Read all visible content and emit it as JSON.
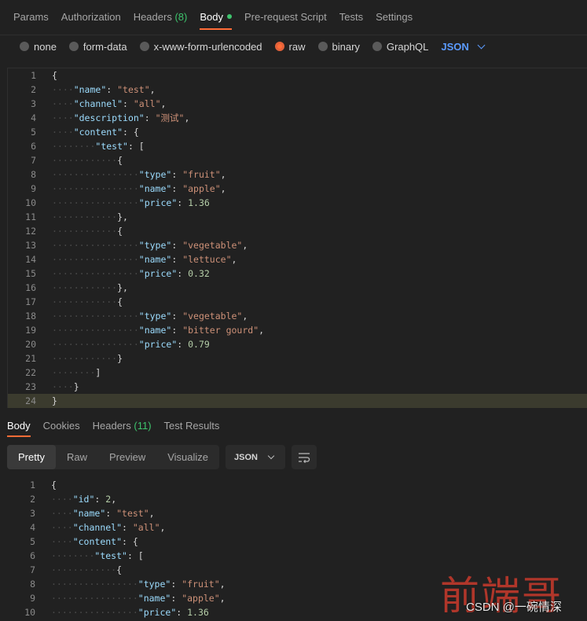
{
  "request_tabs": [
    {
      "label": "Params"
    },
    {
      "label": "Authorization"
    },
    {
      "label": "Headers",
      "count": "(8)"
    },
    {
      "label": "Body"
    },
    {
      "label": "Pre-request Script"
    },
    {
      "label": "Tests"
    },
    {
      "label": "Settings"
    }
  ],
  "body_types": [
    {
      "label": "none",
      "checked": false
    },
    {
      "label": "form-data",
      "checked": false
    },
    {
      "label": "x-www-form-urlencoded",
      "checked": false
    },
    {
      "label": "raw",
      "checked": true
    },
    {
      "label": "binary",
      "checked": false
    },
    {
      "label": "GraphQL",
      "checked": false
    }
  ],
  "raw_language": "JSON",
  "request_body_lines": [
    {
      "n": "1",
      "indent": 0,
      "t": [
        [
          "p",
          "{"
        ]
      ]
    },
    {
      "n": "2",
      "indent": 1,
      "t": [
        [
          "k",
          "\"name\""
        ],
        [
          "p",
          ": "
        ],
        [
          "s",
          "\"test\""
        ],
        [
          "p",
          ","
        ]
      ]
    },
    {
      "n": "3",
      "indent": 1,
      "t": [
        [
          "k",
          "\"channel\""
        ],
        [
          "p",
          ": "
        ],
        [
          "s",
          "\"all\""
        ],
        [
          "p",
          ","
        ]
      ]
    },
    {
      "n": "4",
      "indent": 1,
      "t": [
        [
          "k",
          "\"description\""
        ],
        [
          "p",
          ": "
        ],
        [
          "s",
          "\"测试\""
        ],
        [
          "p",
          ","
        ]
      ]
    },
    {
      "n": "5",
      "indent": 1,
      "t": [
        [
          "k",
          "\"content\""
        ],
        [
          "p",
          ": {"
        ]
      ]
    },
    {
      "n": "6",
      "indent": 2,
      "t": [
        [
          "k",
          "\"test\""
        ],
        [
          "p",
          ": ["
        ]
      ]
    },
    {
      "n": "7",
      "indent": 3,
      "t": [
        [
          "p",
          "{"
        ]
      ]
    },
    {
      "n": "8",
      "indent": 4,
      "t": [
        [
          "k",
          "\"type\""
        ],
        [
          "p",
          ": "
        ],
        [
          "s",
          "\"fruit\""
        ],
        [
          "p",
          ","
        ]
      ]
    },
    {
      "n": "9",
      "indent": 4,
      "t": [
        [
          "k",
          "\"name\""
        ],
        [
          "p",
          ": "
        ],
        [
          "s",
          "\"apple\""
        ],
        [
          "p",
          ","
        ]
      ]
    },
    {
      "n": "10",
      "indent": 4,
      "t": [
        [
          "k",
          "\"price\""
        ],
        [
          "p",
          ": "
        ],
        [
          "n",
          "1.36"
        ]
      ]
    },
    {
      "n": "11",
      "indent": 3,
      "t": [
        [
          "p",
          "},"
        ]
      ]
    },
    {
      "n": "12",
      "indent": 3,
      "t": [
        [
          "p",
          "{"
        ]
      ]
    },
    {
      "n": "13",
      "indent": 4,
      "t": [
        [
          "k",
          "\"type\""
        ],
        [
          "p",
          ": "
        ],
        [
          "s",
          "\"vegetable\""
        ],
        [
          "p",
          ","
        ]
      ]
    },
    {
      "n": "14",
      "indent": 4,
      "t": [
        [
          "k",
          "\"name\""
        ],
        [
          "p",
          ": "
        ],
        [
          "s",
          "\"lettuce\""
        ],
        [
          "p",
          ","
        ]
      ]
    },
    {
      "n": "15",
      "indent": 4,
      "t": [
        [
          "k",
          "\"price\""
        ],
        [
          "p",
          ": "
        ],
        [
          "n",
          "0.32"
        ]
      ]
    },
    {
      "n": "16",
      "indent": 3,
      "t": [
        [
          "p",
          "},"
        ]
      ]
    },
    {
      "n": "17",
      "indent": 3,
      "t": [
        [
          "p",
          "{"
        ]
      ]
    },
    {
      "n": "18",
      "indent": 4,
      "t": [
        [
          "k",
          "\"type\""
        ],
        [
          "p",
          ": "
        ],
        [
          "s",
          "\"vegetable\""
        ],
        [
          "p",
          ","
        ]
      ]
    },
    {
      "n": "19",
      "indent": 4,
      "t": [
        [
          "k",
          "\"name\""
        ],
        [
          "p",
          ": "
        ],
        [
          "s",
          "\"bitter gourd\""
        ],
        [
          "p",
          ","
        ]
      ]
    },
    {
      "n": "20",
      "indent": 4,
      "t": [
        [
          "k",
          "\"price\""
        ],
        [
          "p",
          ": "
        ],
        [
          "n",
          "0.79"
        ]
      ]
    },
    {
      "n": "21",
      "indent": 3,
      "t": [
        [
          "p",
          "}"
        ]
      ]
    },
    {
      "n": "22",
      "indent": 2,
      "t": [
        [
          "p",
          "]"
        ]
      ]
    },
    {
      "n": "23",
      "indent": 1,
      "t": [
        [
          "p",
          "}"
        ]
      ]
    },
    {
      "n": "24",
      "indent": 0,
      "t": [
        [
          "p",
          "}"
        ]
      ]
    }
  ],
  "active_line": "24",
  "response_tabs": [
    {
      "label": "Body"
    },
    {
      "label": "Cookies"
    },
    {
      "label": "Headers",
      "count": "(11)"
    },
    {
      "label": "Test Results"
    }
  ],
  "view_modes": [
    {
      "label": "Pretty"
    },
    {
      "label": "Raw"
    },
    {
      "label": "Preview"
    },
    {
      "label": "Visualize"
    }
  ],
  "response_format": "JSON",
  "response_body_lines": [
    {
      "n": "1",
      "indent": 0,
      "t": [
        [
          "p",
          "{"
        ]
      ]
    },
    {
      "n": "2",
      "indent": 1,
      "t": [
        [
          "k",
          "\"id\""
        ],
        [
          "p",
          ": "
        ],
        [
          "n",
          "2"
        ],
        [
          "p",
          ","
        ]
      ]
    },
    {
      "n": "3",
      "indent": 1,
      "t": [
        [
          "k",
          "\"name\""
        ],
        [
          "p",
          ": "
        ],
        [
          "s",
          "\"test\""
        ],
        [
          "p",
          ","
        ]
      ]
    },
    {
      "n": "4",
      "indent": 1,
      "t": [
        [
          "k",
          "\"channel\""
        ],
        [
          "p",
          ": "
        ],
        [
          "s",
          "\"all\""
        ],
        [
          "p",
          ","
        ]
      ]
    },
    {
      "n": "5",
      "indent": 1,
      "t": [
        [
          "k",
          "\"content\""
        ],
        [
          "p",
          ": {"
        ]
      ]
    },
    {
      "n": "6",
      "indent": 2,
      "t": [
        [
          "k",
          "\"test\""
        ],
        [
          "p",
          ": ["
        ]
      ]
    },
    {
      "n": "7",
      "indent": 3,
      "t": [
        [
          "p",
          "{"
        ]
      ]
    },
    {
      "n": "8",
      "indent": 4,
      "t": [
        [
          "k",
          "\"type\""
        ],
        [
          "p",
          ": "
        ],
        [
          "s",
          "\"fruit\""
        ],
        [
          "p",
          ","
        ]
      ]
    },
    {
      "n": "9",
      "indent": 4,
      "t": [
        [
          "k",
          "\"name\""
        ],
        [
          "p",
          ": "
        ],
        [
          "s",
          "\"apple\""
        ],
        [
          "p",
          ","
        ]
      ]
    },
    {
      "n": "10",
      "indent": 4,
      "t": [
        [
          "k",
          "\"price\""
        ],
        [
          "p",
          ": "
        ],
        [
          "n",
          "1.36"
        ]
      ]
    }
  ],
  "watermark": "前端哥",
  "csdn_credit": "CSDN @一碗情深",
  "colors": {
    "accent": "#ff6c37",
    "count_green": "#3ec46d",
    "json_link": "#5b9bff"
  }
}
